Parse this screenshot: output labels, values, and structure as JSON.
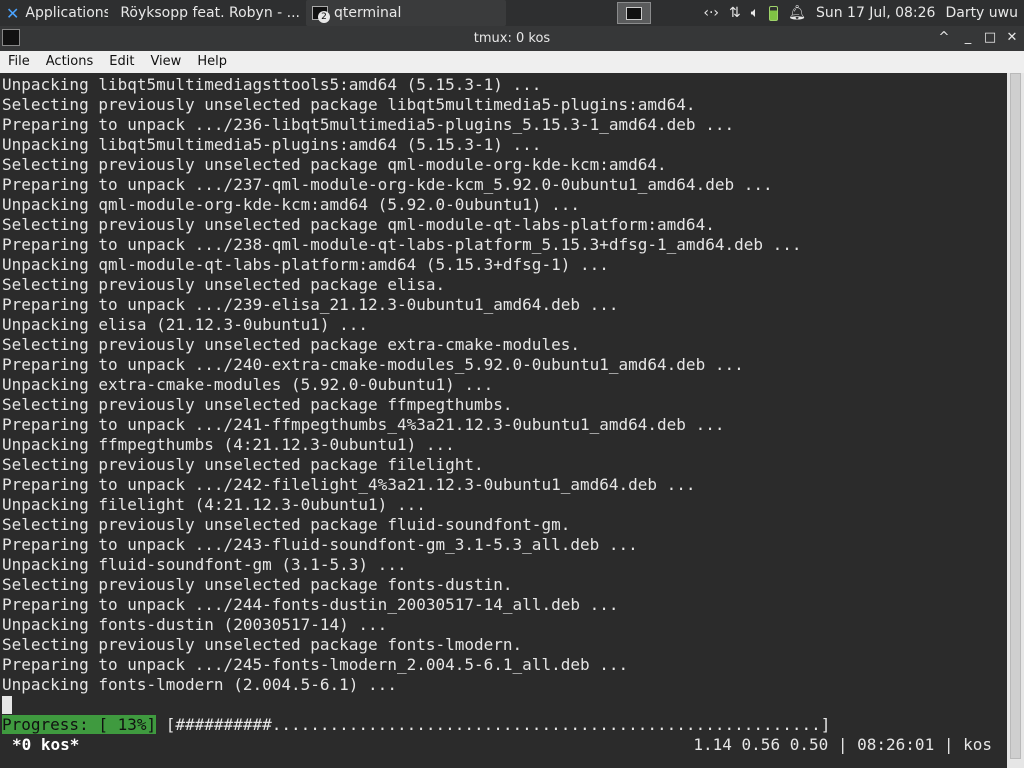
{
  "panel": {
    "apps_label": "Applications",
    "firefox_label": "Röyksopp feat. Robyn - ...",
    "qterminal_label": "qterminal",
    "qterminal_badge": "2",
    "clock": "Sun 17 Jul, 08:26",
    "user": "Darty uwu"
  },
  "window": {
    "title": "tmux: 0 kos"
  },
  "menu": [
    "File",
    "Actions",
    "Edit",
    "View",
    "Help"
  ],
  "terminal": {
    "lines": [
      "Unpacking libqt5multimediagsttools5:amd64 (5.15.3-1) ...",
      "Selecting previously unselected package libqt5multimedia5-plugins:amd64.",
      "Preparing to unpack .../236-libqt5multimedia5-plugins_5.15.3-1_amd64.deb ...",
      "Unpacking libqt5multimedia5-plugins:amd64 (5.15.3-1) ...",
      "Selecting previously unselected package qml-module-org-kde-kcm:amd64.",
      "Preparing to unpack .../237-qml-module-org-kde-kcm_5.92.0-0ubuntu1_amd64.deb ...",
      "Unpacking qml-module-org-kde-kcm:amd64 (5.92.0-0ubuntu1) ...",
      "Selecting previously unselected package qml-module-qt-labs-platform:amd64.",
      "Preparing to unpack .../238-qml-module-qt-labs-platform_5.15.3+dfsg-1_amd64.deb ...",
      "Unpacking qml-module-qt-labs-platform:amd64 (5.15.3+dfsg-1) ...",
      "Selecting previously unselected package elisa.",
      "Preparing to unpack .../239-elisa_21.12.3-0ubuntu1_amd64.deb ...",
      "Unpacking elisa (21.12.3-0ubuntu1) ...",
      "Selecting previously unselected package extra-cmake-modules.",
      "Preparing to unpack .../240-extra-cmake-modules_5.92.0-0ubuntu1_amd64.deb ...",
      "Unpacking extra-cmake-modules (5.92.0-0ubuntu1) ...",
      "Selecting previously unselected package ffmpegthumbs.",
      "Preparing to unpack .../241-ffmpegthumbs_4%3a21.12.3-0ubuntu1_amd64.deb ...",
      "Unpacking ffmpegthumbs (4:21.12.3-0ubuntu1) ...",
      "Selecting previously unselected package filelight.",
      "Preparing to unpack .../242-filelight_4%3a21.12.3-0ubuntu1_amd64.deb ...",
      "Unpacking filelight (4:21.12.3-0ubuntu1) ...",
      "Selecting previously unselected package fluid-soundfont-gm.",
      "Preparing to unpack .../243-fluid-soundfont-gm_3.1-5.3_all.deb ...",
      "Unpacking fluid-soundfont-gm (3.1-5.3) ...",
      "Selecting previously unselected package fonts-dustin.",
      "Preparing to unpack .../244-fonts-dustin_20030517-14_all.deb ...",
      "Unpacking fonts-dustin (20030517-14) ...",
      "Selecting previously unselected package fonts-lmodern.",
      "Preparing to unpack .../245-fonts-lmodern_2.004.5-6.1_all.deb ...",
      "Unpacking fonts-lmodern (2.004.5-6.1) ..."
    ],
    "progress_label": "Progress: [ 13%]",
    "progress_bar": " [##########.........................................................]",
    "progress_percent": 13
  },
  "tmux_status": {
    "window": "*0 kos*",
    "right": "1.14 0.56 0.50 | 08:26:01 | kos"
  }
}
